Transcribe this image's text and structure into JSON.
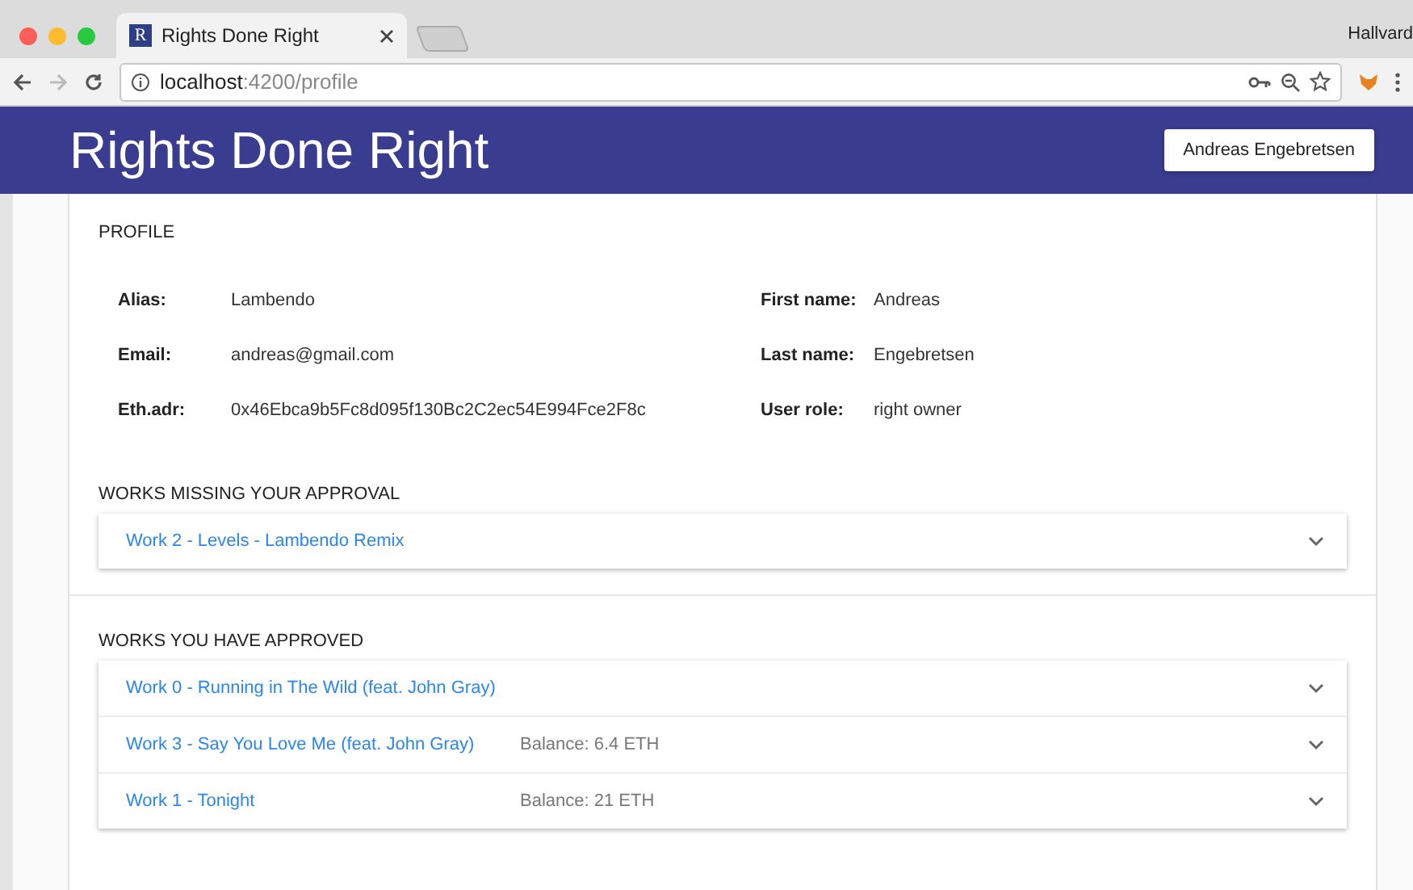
{
  "browser": {
    "favicon_letter": "R",
    "tab_title": "Rights Done Right",
    "profile_name": "Hallvard",
    "url_host": "localhost",
    "url_path": ":4200/profile"
  },
  "header": {
    "title": "Rights Done Right",
    "user_button": "Andreas Engebretsen"
  },
  "profile": {
    "heading": "PROFILE",
    "fields": [
      {
        "label": "Alias:",
        "value": "Lambendo"
      },
      {
        "label": "First name:",
        "value": "Andreas"
      },
      {
        "label": "Email:",
        "value": "andreas@gmail.com"
      },
      {
        "label": "Last name:",
        "value": "Engebretsen"
      },
      {
        "label": "Eth.adr:",
        "value": "0x46Ebca9b5Fc8d095f130Bc2C2ec54E994Fce2F8c"
      },
      {
        "label": "User role:",
        "value": "right owner"
      }
    ]
  },
  "sections": [
    {
      "heading": "WORKS MISSING YOUR APPROVAL",
      "works": [
        {
          "title": "Work 2 - Levels - Lambendo Remix",
          "expanded": false
        }
      ]
    },
    {
      "heading": "WORKS YOU HAVE APPROVED",
      "works": [
        {
          "title": "Work 0 - Running in The Wild (feat. John Gray)",
          "expanded": false
        },
        {
          "title": "Work 3 - Say You Love Me (feat. John Gray)",
          "balance": "Balance: 6.4 ETH",
          "expanded": false
        },
        {
          "title": "Work 1 - Tonight",
          "balance": "Balance: 21 ETH",
          "expanded": false
        }
      ]
    }
  ]
}
